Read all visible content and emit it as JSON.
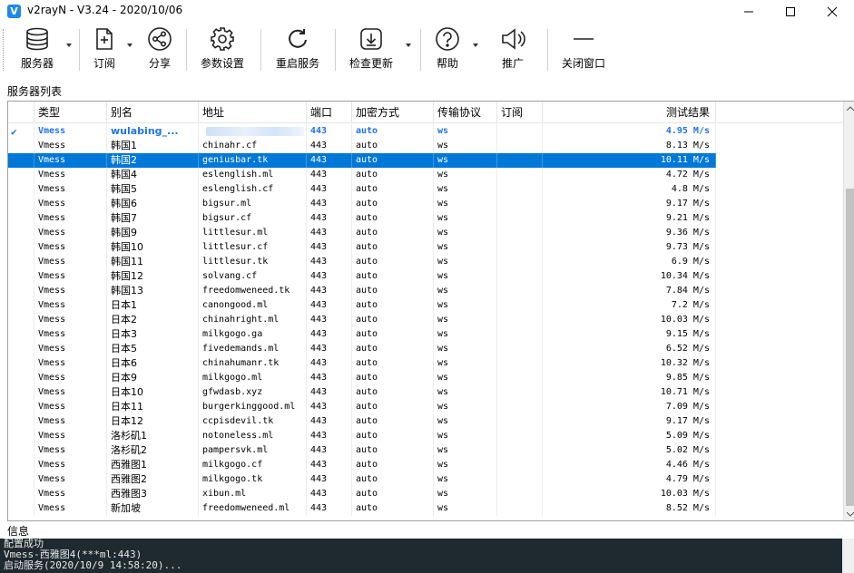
{
  "window": {
    "title": "v2rayN - V3.24 - 2020/10/06",
    "app_icon": "V"
  },
  "toolbar": [
    {
      "label": "服务器",
      "icon": "database-icon",
      "dropdown": true
    },
    {
      "label": "订阅",
      "icon": "subscribe-add-icon",
      "dropdown": true
    },
    {
      "label": "分享",
      "icon": "share-icon",
      "dropdown": false
    },
    {
      "label": "参数设置",
      "icon": "gear-icon",
      "dropdown": false
    },
    {
      "label": "重启服务",
      "icon": "refresh-icon",
      "dropdown": false
    },
    {
      "label": "检查更新",
      "icon": "download-icon",
      "dropdown": true
    },
    {
      "label": "帮助",
      "icon": "help-icon",
      "dropdown": true
    },
    {
      "label": "推广",
      "icon": "speaker-icon",
      "dropdown": false
    },
    {
      "label": "关闭窗口",
      "icon": "minus-icon",
      "dropdown": false
    }
  ],
  "server_list_label": "服务器列表",
  "columns": [
    "类型",
    "别名",
    "地址",
    "端口",
    "加密方式",
    "传输协议",
    "订阅",
    "测试结果"
  ],
  "rows": [
    {
      "type": "Vmess",
      "alias": "wulabing_...",
      "address": "",
      "port": "443",
      "security": "auto",
      "network": "ws",
      "sub": "",
      "result": "4.95 M/s",
      "active": true,
      "selected": false,
      "redacted": true
    },
    {
      "type": "Vmess",
      "alias": "韩国1",
      "address": "chinahr.cf",
      "port": "443",
      "security": "auto",
      "network": "ws",
      "sub": "",
      "result": "8.13 M/s"
    },
    {
      "type": "Vmess",
      "alias": "韩国2",
      "address": "geniusbar.tk",
      "port": "443",
      "security": "auto",
      "network": "ws",
      "sub": "",
      "result": "10.11 M/s",
      "selected": true
    },
    {
      "type": "Vmess",
      "alias": "韩国4",
      "address": "eslenglish.ml",
      "port": "443",
      "security": "auto",
      "network": "ws",
      "sub": "",
      "result": "4.72 M/s"
    },
    {
      "type": "Vmess",
      "alias": "韩国5",
      "address": "eslenglish.cf",
      "port": "443",
      "security": "auto",
      "network": "ws",
      "sub": "",
      "result": "4.8 M/s"
    },
    {
      "type": "Vmess",
      "alias": "韩国6",
      "address": "bigsur.ml",
      "port": "443",
      "security": "auto",
      "network": "ws",
      "sub": "",
      "result": "9.17 M/s"
    },
    {
      "type": "Vmess",
      "alias": "韩国7",
      "address": "bigsur.cf",
      "port": "443",
      "security": "auto",
      "network": "ws",
      "sub": "",
      "result": "9.21 M/s"
    },
    {
      "type": "Vmess",
      "alias": "韩国9",
      "address": "littlesur.ml",
      "port": "443",
      "security": "auto",
      "network": "ws",
      "sub": "",
      "result": "9.36 M/s"
    },
    {
      "type": "Vmess",
      "alias": "韩国10",
      "address": "littlesur.cf",
      "port": "443",
      "security": "auto",
      "network": "ws",
      "sub": "",
      "result": "9.73 M/s"
    },
    {
      "type": "Vmess",
      "alias": "韩国11",
      "address": "littlesur.tk",
      "port": "443",
      "security": "auto",
      "network": "ws",
      "sub": "",
      "result": "6.9 M/s"
    },
    {
      "type": "Vmess",
      "alias": "韩国12",
      "address": "solvang.cf",
      "port": "443",
      "security": "auto",
      "network": "ws",
      "sub": "",
      "result": "10.34 M/s"
    },
    {
      "type": "Vmess",
      "alias": "韩国13",
      "address": "freedomweneed.tk",
      "port": "443",
      "security": "auto",
      "network": "ws",
      "sub": "",
      "result": "7.84 M/s"
    },
    {
      "type": "Vmess",
      "alias": "日本1",
      "address": "canongood.ml",
      "port": "443",
      "security": "auto",
      "network": "ws",
      "sub": "",
      "result": "7.2 M/s"
    },
    {
      "type": "Vmess",
      "alias": "日本2",
      "address": "chinahright.ml",
      "port": "443",
      "security": "auto",
      "network": "ws",
      "sub": "",
      "result": "10.03 M/s"
    },
    {
      "type": "Vmess",
      "alias": "日本3",
      "address": "milkgogo.ga",
      "port": "443",
      "security": "auto",
      "network": "ws",
      "sub": "",
      "result": "9.15 M/s"
    },
    {
      "type": "Vmess",
      "alias": "日本5",
      "address": "fivedemands.ml",
      "port": "443",
      "security": "auto",
      "network": "ws",
      "sub": "",
      "result": "6.52 M/s"
    },
    {
      "type": "Vmess",
      "alias": "日本6",
      "address": "chinahumanr.tk",
      "port": "443",
      "security": "auto",
      "network": "ws",
      "sub": "",
      "result": "10.32 M/s"
    },
    {
      "type": "Vmess",
      "alias": "日本9",
      "address": "milkgogo.ml",
      "port": "443",
      "security": "auto",
      "network": "ws",
      "sub": "",
      "result": "9.85 M/s"
    },
    {
      "type": "Vmess",
      "alias": "日本10",
      "address": "gfwdasb.xyz",
      "port": "443",
      "security": "auto",
      "network": "ws",
      "sub": "",
      "result": "10.71 M/s"
    },
    {
      "type": "Vmess",
      "alias": "日本11",
      "address": "burgerkinggood.ml",
      "port": "443",
      "security": "auto",
      "network": "ws",
      "sub": "",
      "result": "7.09 M/s"
    },
    {
      "type": "Vmess",
      "alias": "日本12",
      "address": "ccpisdevil.tk",
      "port": "443",
      "security": "auto",
      "network": "ws",
      "sub": "",
      "result": "9.17 M/s"
    },
    {
      "type": "Vmess",
      "alias": "洛杉矶1",
      "address": "notoneless.ml",
      "port": "443",
      "security": "auto",
      "network": "ws",
      "sub": "",
      "result": "5.09 M/s"
    },
    {
      "type": "Vmess",
      "alias": "洛杉矶2",
      "address": "pampersvk.ml",
      "port": "443",
      "security": "auto",
      "network": "ws",
      "sub": "",
      "result": "5.02 M/s"
    },
    {
      "type": "Vmess",
      "alias": "西雅图1",
      "address": "milkgogo.cf",
      "port": "443",
      "security": "auto",
      "network": "ws",
      "sub": "",
      "result": "4.46 M/s"
    },
    {
      "type": "Vmess",
      "alias": "西雅图2",
      "address": "milkgogo.tk",
      "port": "443",
      "security": "auto",
      "network": "ws",
      "sub": "",
      "result": "4.79 M/s"
    },
    {
      "type": "Vmess",
      "alias": "西雅图3",
      "address": "xibun.ml",
      "port": "443",
      "security": "auto",
      "network": "ws",
      "sub": "",
      "result": "10.03 M/s"
    },
    {
      "type": "Vmess",
      "alias": "新加坡",
      "address": "freedomweneed.ml",
      "port": "443",
      "security": "auto",
      "network": "ws",
      "sub": "",
      "result": "8.52 M/s"
    }
  ],
  "info_label": "信息",
  "console_lines": [
    "配置成功",
    "Vmess-西雅图4(***ml:443)",
    "启动服务(2020/10/9 14:58:20)..."
  ],
  "colors": {
    "selection": "#0078d7",
    "active_row_text": "#1e73e8",
    "console_bg": "#1f2a30"
  }
}
